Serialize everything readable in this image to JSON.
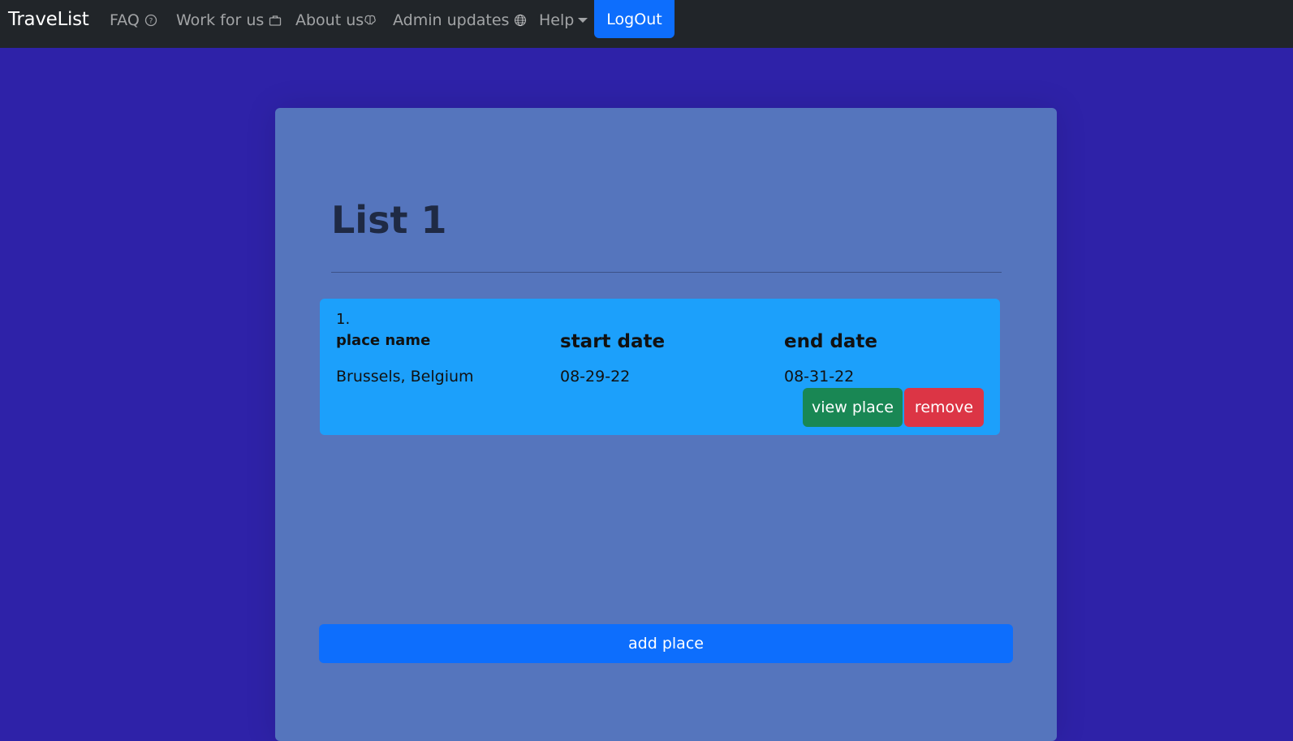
{
  "nav": {
    "brand": "TraveList",
    "faq": "FAQ",
    "work": "Work for us",
    "about": "About us",
    "admin": "Admin updates",
    "help": "Help",
    "logout": "LogOut"
  },
  "list": {
    "title": "List 1",
    "places": [
      {
        "index": "1.",
        "name_header": "place name",
        "start_header": "start date",
        "end_header": "end date",
        "name": "Brussels, Belgium",
        "start": "08-29-22",
        "end": "08-31-22",
        "view_label": "view place",
        "remove_label": "remove"
      }
    ],
    "add_label": "add place"
  },
  "colors": {
    "background": "#2e22a8",
    "navbar": "#212529",
    "card": "#5575bd",
    "place_box": "#1ca0fb",
    "primary": "#0d6efd",
    "success": "#198754",
    "danger": "#dc3545"
  }
}
